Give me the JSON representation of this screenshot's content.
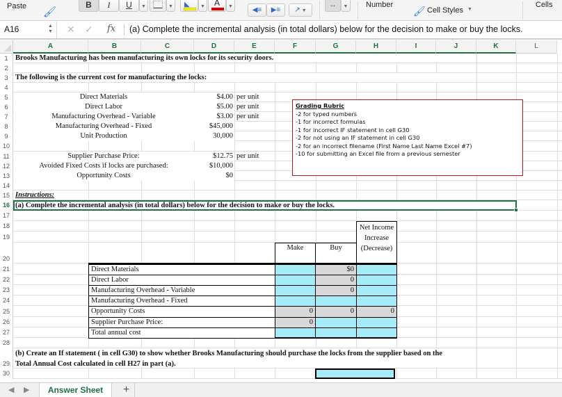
{
  "ribbon": {
    "paste_label": "Paste",
    "bold_label": "B",
    "italic_label": "I",
    "underline_label": "U",
    "number_label": "Number",
    "cell_styles_label": "Cell Styles",
    "cells_label": "Cells",
    "fill_color": "#ffff00",
    "font_color": "#e00000"
  },
  "formula_bar": {
    "name_box": "A16",
    "fx_label": "fx",
    "content": "(a) Complete the incremental analysis (in total dollars) below for the decision to make or buy the locks."
  },
  "columns": [
    "A",
    "B",
    "C",
    "D",
    "E",
    "F",
    "G",
    "H",
    "I",
    "J",
    "K",
    "L"
  ],
  "rows": [
    "1",
    "2",
    "3",
    "4",
    "5",
    "6",
    "7",
    "8",
    "9",
    "10",
    "11",
    "12",
    "13",
    "14",
    "15",
    "16",
    "17",
    "18",
    "19",
    "20",
    "21",
    "22",
    "23",
    "24",
    "25",
    "26",
    "27",
    "28",
    "29",
    "30"
  ],
  "sheet": {
    "r1": "Brooks Manufacturing has been manufacturing its own locks for its security doors.",
    "r3": "The following is the current cost for  manufacturing the locks:",
    "costs": [
      {
        "label": "Direct Materials",
        "value": "$4.00",
        "unit": "per unit"
      },
      {
        "label": "Direct Labor",
        "value": "$5.00",
        "unit": "per unit"
      },
      {
        "label": "Manufacturing Overhead - Variable",
        "value": "$3.00",
        "unit": "per unit"
      },
      {
        "label": "Manufacturing Overhead - Fixed",
        "value": "$45,000",
        "unit": ""
      },
      {
        "label": "Unit Production",
        "value": "30,000",
        "unit": ""
      }
    ],
    "supplier": [
      {
        "label": "Supplier Purchase Price:",
        "value": "$12.75",
        "unit": "per unit"
      },
      {
        "label": "Avoided Fixed Costs if locks are purchased:",
        "value": "$10,000",
        "unit": ""
      },
      {
        "label": "Opportunity Costs",
        "value": "$0",
        "unit": ""
      }
    ],
    "r15": "Instructions:",
    "r16": "(a) Complete the incremental analysis (in total dollars) below for the decision to make or buy the locks.",
    "r29_line1": "(b) Create an If statement ( in cell G30) to show whether Brooks Manufacturing should purchase the locks from the supplier based on the",
    "r29_line2": "Total Annual Cost calculated in cell H27 in part (a)."
  },
  "rubric": {
    "title": "Grading Rubric",
    "items": [
      "-2 for typed numbers",
      "-1 for incorrect formulas",
      "-1 for incorrect IF statement in cell G30",
      "-2 for not using an IF statement in cell G30",
      "-2 for an incorrect filename (First Name Last Name Excel #7)",
      "-10 for submitting an Excel file from a previous semester"
    ]
  },
  "analysis": {
    "headers": {
      "make": "Make",
      "buy": "Buy",
      "net_line1": "Net Income",
      "net_line2": "Increase",
      "net_line3": "(Decrease)"
    },
    "rows": [
      {
        "label": "Direct Materials",
        "make": "",
        "buy": "$0",
        "net": ""
      },
      {
        "label": "Direct Labor",
        "make": "",
        "buy": "0",
        "net": ""
      },
      {
        "label": "Manufacturing Overhead - Variable",
        "make": "",
        "buy": "0",
        "net": ""
      },
      {
        "label": "Manufacturing Overhead - Fixed",
        "make": "",
        "buy": "",
        "net": ""
      },
      {
        "label": "Opportunity Costs",
        "make": "0",
        "buy": "0",
        "net": "0"
      },
      {
        "label": "Supplier Purchase Price:",
        "make": "0",
        "buy": "",
        "net": ""
      },
      {
        "label": "Total annual cost",
        "make": "",
        "buy": "",
        "net": ""
      }
    ]
  },
  "colors": {
    "input_cell": "#a6ecf8",
    "formula_cell": "#d8d8d8",
    "selection": "#1f7145",
    "rubric_border": "#b2141a"
  },
  "tabs": {
    "active": "Answer Sheet",
    "add_label": "+"
  }
}
